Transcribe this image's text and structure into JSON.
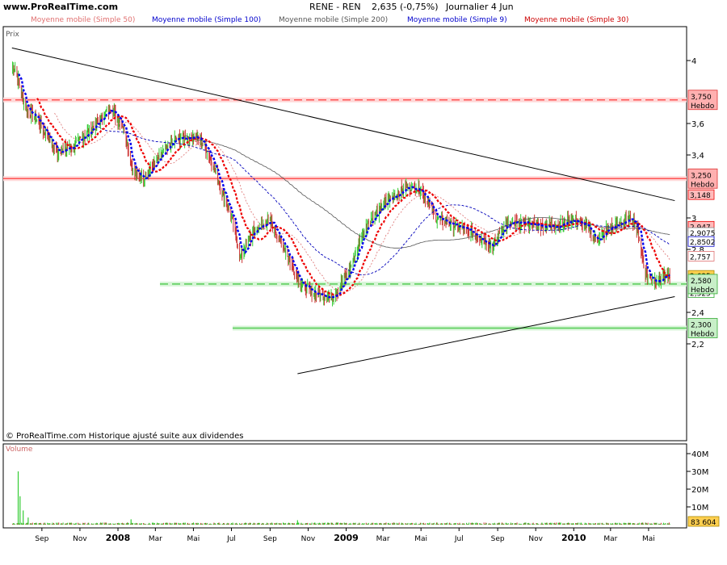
{
  "header": {
    "site": "www.ProRealTime.com",
    "instrument": "RENE - REN",
    "quote": "2,635 (-0,75%)",
    "period": "Journalier  4 Jun"
  },
  "panel_labels": {
    "price": "Prix",
    "volume": "Volume",
    "copyright": "© ProRealTime.com Historique ajusté suite aux dividendes"
  },
  "legend": [
    {
      "label": "Moyenne mobile (Simple 50)",
      "color": "#e07070"
    },
    {
      "label": "Moyenne mobile (Simple 100)",
      "color": "#0000cc"
    },
    {
      "label": "Moyenne mobile (Simple 200)",
      "color": "#555555"
    },
    {
      "label": "Moyenne mobile (Simple 9)",
      "color": "#0000cc"
    },
    {
      "label": "Moyenne mobile (Simple 30)",
      "color": "#cc0000"
    }
  ],
  "colors": {
    "up": "#33cc33",
    "down": "#cc3333",
    "mm9": "#0000ee",
    "mm30": "#ee0000",
    "mm50": "#e08080",
    "mm100": "#0000bb",
    "mm200": "#555555",
    "resistance": "#ff5555",
    "support": "#55cc55",
    "trend": "#000000"
  },
  "chart_data": {
    "type": "line",
    "title": "RENE - REN",
    "y_ticks": [
      "4",
      "3,6",
      "3,4",
      "3",
      "2,8",
      "2,4",
      "2,2"
    ],
    "x_ticks": [
      "Sep",
      "Nov",
      "2008",
      "Mar",
      "Mai",
      "Jul",
      "Sep",
      "Nov",
      "2009",
      "Mar",
      "Mai",
      "Jul",
      "Sep",
      "Nov",
      "2010",
      "Mar",
      "Mai"
    ],
    "price_points": [
      {
        "x": "2007-07-20",
        "y": 3.95
      },
      {
        "x": "2007-08-05",
        "y": 3.7
      },
      {
        "x": "2007-08-25",
        "y": 3.62
      },
      {
        "x": "2007-09-25",
        "y": 3.42
      },
      {
        "x": "2007-10-20",
        "y": 3.45
      },
      {
        "x": "2007-11-15",
        "y": 3.55
      },
      {
        "x": "2007-12-20",
        "y": 3.7
      },
      {
        "x": "2008-01-10",
        "y": 3.58
      },
      {
        "x": "2008-01-25",
        "y": 3.3
      },
      {
        "x": "2008-02-10",
        "y": 3.25
      },
      {
        "x": "2008-03-01",
        "y": 3.35
      },
      {
        "x": "2008-04-01",
        "y": 3.5
      },
      {
        "x": "2008-05-05",
        "y": 3.52
      },
      {
        "x": "2008-05-25",
        "y": 3.42
      },
      {
        "x": "2008-06-15",
        "y": 3.18
      },
      {
        "x": "2008-07-05",
        "y": 2.95
      },
      {
        "x": "2008-07-15",
        "y": 2.75
      },
      {
        "x": "2008-08-05",
        "y": 2.92
      },
      {
        "x": "2008-09-01",
        "y": 2.98
      },
      {
        "x": "2008-09-25",
        "y": 2.8
      },
      {
        "x": "2008-10-20",
        "y": 2.58
      },
      {
        "x": "2008-11-10",
        "y": 2.52
      },
      {
        "x": "2008-12-10",
        "y": 2.5
      },
      {
        "x": "2009-01-05",
        "y": 2.65
      },
      {
        "x": "2009-02-01",
        "y": 2.95
      },
      {
        "x": "2009-03-10",
        "y": 3.12
      },
      {
        "x": "2009-04-10",
        "y": 3.2
      },
      {
        "x": "2009-05-01",
        "y": 3.18
      },
      {
        "x": "2009-05-25",
        "y": 3.0
      },
      {
        "x": "2009-06-25",
        "y": 2.95
      },
      {
        "x": "2009-07-25",
        "y": 2.9
      },
      {
        "x": "2009-08-25",
        "y": 2.82
      },
      {
        "x": "2009-09-10",
        "y": 2.95
      },
      {
        "x": "2009-10-10",
        "y": 2.97
      },
      {
        "x": "2009-11-10",
        "y": 2.95
      },
      {
        "x": "2009-12-05",
        "y": 2.95
      },
      {
        "x": "2010-01-01",
        "y": 2.99
      },
      {
        "x": "2010-01-25",
        "y": 2.93
      },
      {
        "x": "2010-02-05",
        "y": 2.85
      },
      {
        "x": "2010-02-25",
        "y": 2.93
      },
      {
        "x": "2010-03-20",
        "y": 2.97
      },
      {
        "x": "2010-04-05",
        "y": 3.0
      },
      {
        "x": "2010-04-15",
        "y": 2.9
      },
      {
        "x": "2010-04-25",
        "y": 2.65
      },
      {
        "x": "2010-05-10",
        "y": 2.6
      },
      {
        "x": "2010-05-25",
        "y": 2.62
      },
      {
        "x": "2010-06-04",
        "y": 2.635
      }
    ],
    "horizontal_levels": [
      {
        "label": "3,750",
        "sub": "Hebdo",
        "y": 3.75,
        "kind": "resistance"
      },
      {
        "label": "3,250",
        "sub": "Hebdo",
        "y": 3.25,
        "kind": "resistance"
      },
      {
        "label": "2,580",
        "sub": "Hebdo",
        "y": 2.58,
        "kind": "support"
      },
      {
        "label": "2,300",
        "sub": "Hebdo",
        "y": 2.3,
        "kind": "support"
      }
    ],
    "right_labels": [
      {
        "label": "3,148",
        "y": 3.148,
        "kind": "red"
      },
      {
        "label": "2,947",
        "y": 2.947,
        "kind": "red"
      },
      {
        "label": "2,9075",
        "y": 2.9075,
        "kind": "grey"
      },
      {
        "label": "2,8502",
        "y": 2.8502,
        "kind": "blue"
      },
      {
        "label": "2,757",
        "y": 2.757,
        "kind": "pink"
      },
      {
        "label": "2,635",
        "y": 2.635,
        "kind": "last"
      },
      {
        "label": "2,525",
        "y": 2.525,
        "kind": "green"
      }
    ],
    "trendlines": [
      {
        "from": {
          "x": "2007-07-15",
          "y": 4.08
        },
        "to": {
          "x": "2010-06-12",
          "y": 3.11
        }
      },
      {
        "from": {
          "x": "2008-10-15",
          "y": 2.01
        },
        "to": {
          "x": "2010-06-12",
          "y": 2.5
        }
      }
    ],
    "volume": {
      "y_ticks": [
        "40M",
        "30M",
        "20M",
        "10M"
      ],
      "last": "83 604",
      "spikes": [
        {
          "x": "2007-07-25",
          "value": 30
        },
        {
          "x": "2007-07-28",
          "value": 16
        },
        {
          "x": "2007-08-02",
          "value": 8
        },
        {
          "x": "2007-08-10",
          "value": 4
        },
        {
          "x": "2008-01-22",
          "value": 3
        },
        {
          "x": "2008-10-15",
          "value": 2.5
        }
      ]
    }
  }
}
